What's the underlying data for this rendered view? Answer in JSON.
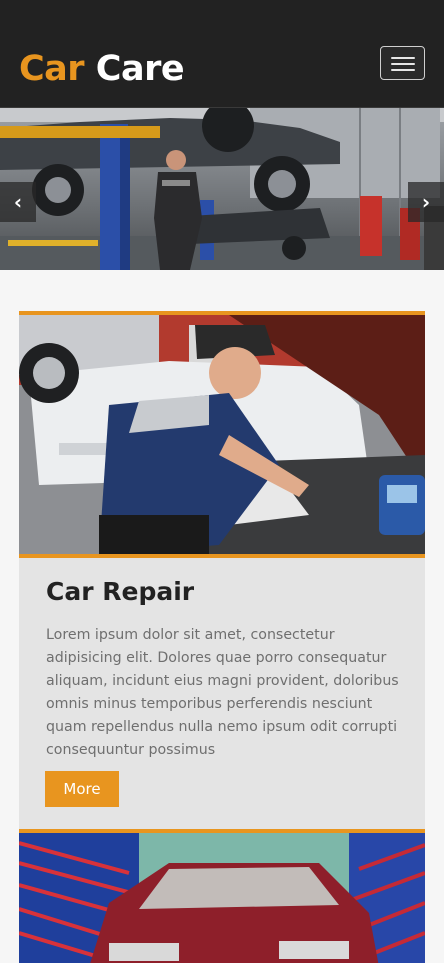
{
  "header": {
    "logo_word1": "Car",
    "logo_word2": "Care",
    "menu_label": "Toggle navigation"
  },
  "slider": {
    "prev_icon": "chevron-left-icon",
    "next_icon": "chevron-right-icon"
  },
  "cards": [
    {
      "title": "Car Repair",
      "text": "Lorem ipsum dolor sit amet, consectetur adipisicing elit. Dolores quae porro consequatur aliquam, incidunt eius magni provident, doloribus omnis minus temporibus perferendis nesciunt quam repellendus nulla nemo ipsum odit corrupti consequuntur possimus",
      "button": "More"
    }
  ],
  "colors": {
    "accent": "#e8951f",
    "header_bg": "#222222",
    "card_bg": "#e4e4e4"
  }
}
